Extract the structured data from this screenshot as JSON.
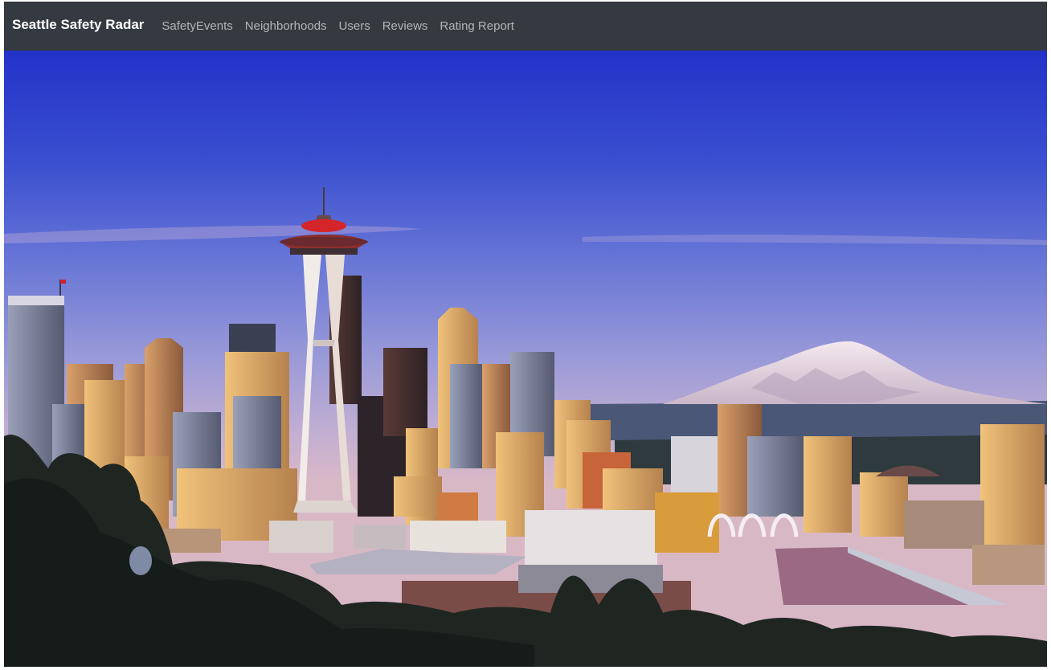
{
  "navbar": {
    "brand": "Seattle Safety Radar",
    "links": [
      "SafetyEvents",
      "Neighborhoods",
      "Users",
      "Reviews",
      "Rating Report"
    ],
    "background": "#343a40"
  },
  "hero": {
    "icon": "seattle-skyline-photo"
  }
}
